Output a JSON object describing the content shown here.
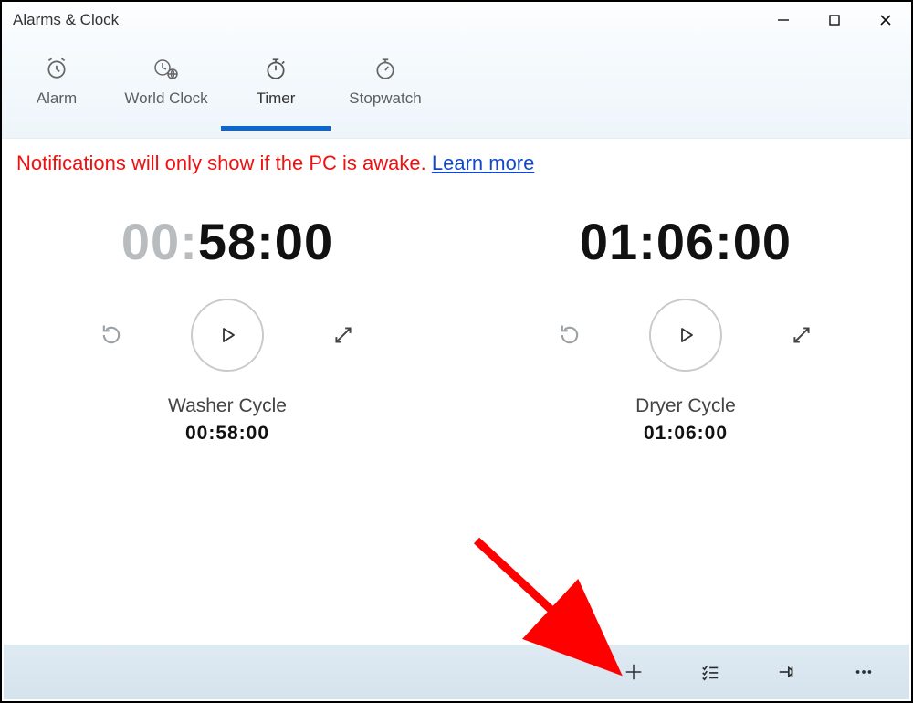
{
  "window": {
    "title": "Alarms & Clock"
  },
  "tabs": {
    "alarm": {
      "label": "Alarm"
    },
    "worldclock": {
      "label": "World Clock"
    },
    "timer": {
      "label": "Timer"
    },
    "stopwatch": {
      "label": "Stopwatch"
    },
    "active": "timer"
  },
  "notice": {
    "text": "Notifications will only show if the PC is awake. ",
    "link": "Learn more"
  },
  "timers": [
    {
      "display_hh_dim": "00",
      "display_mmss": "58:00",
      "name": "Washer Cycle",
      "duration": "00:58:00"
    },
    {
      "display_full": "01:06:00",
      "name": "Dryer Cycle",
      "duration": "01:06:00"
    }
  ],
  "commands": {
    "add": "Add new timer",
    "list": "Edit timers",
    "pin": "Pin to Start",
    "more": "More"
  }
}
